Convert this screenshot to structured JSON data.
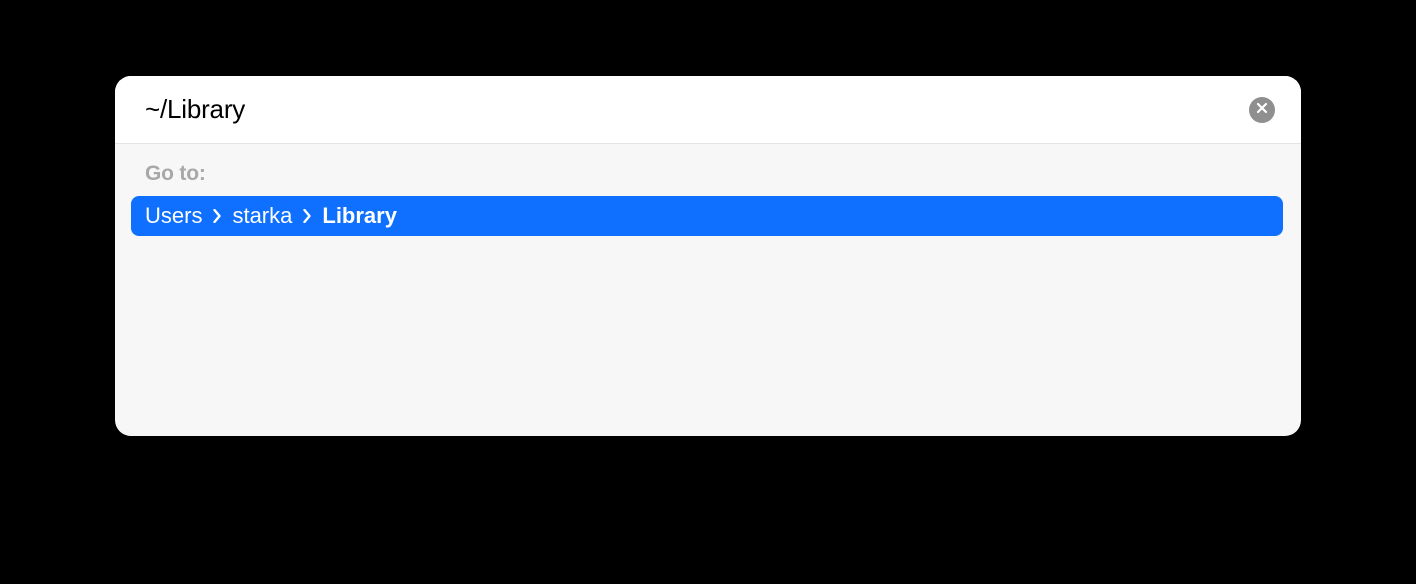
{
  "input": {
    "value": "~/Library"
  },
  "goto_label": "Go to:",
  "result": {
    "segments": [
      {
        "label": "Users",
        "bold": false
      },
      {
        "label": "starka",
        "bold": false
      },
      {
        "label": "Library",
        "bold": true
      }
    ]
  }
}
